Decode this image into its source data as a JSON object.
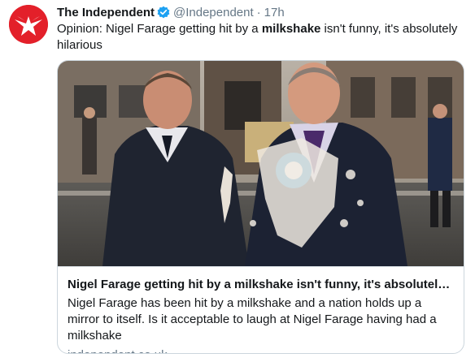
{
  "tweet": {
    "display_name": "The Independent",
    "handle": "@Independent",
    "separator": "·",
    "time": "17h",
    "text_before": "Opinion: Nigel Farage getting hit by a ",
    "text_bold": "milkshake",
    "text_after": " isn't funny, it's absolutely hilarious",
    "avatar_icon": "independent-eagle-logo",
    "verified_icon": "verified-badge-icon"
  },
  "card": {
    "title": "Nigel Farage getting hit by a milkshake isn't funny, it's absolutely hilarious",
    "description": "Nigel Farage has been hit by a milkshake and a nation holds up a mirror to itself. Is it acceptable to laugh at Nigel Farage having had a milkshake",
    "domain": "independent.co.uk"
  },
  "colors": {
    "brand_red": "#e3202a",
    "verified_blue": "#1da1f2",
    "secondary_text": "#657786",
    "border": "#ccd6dd"
  }
}
